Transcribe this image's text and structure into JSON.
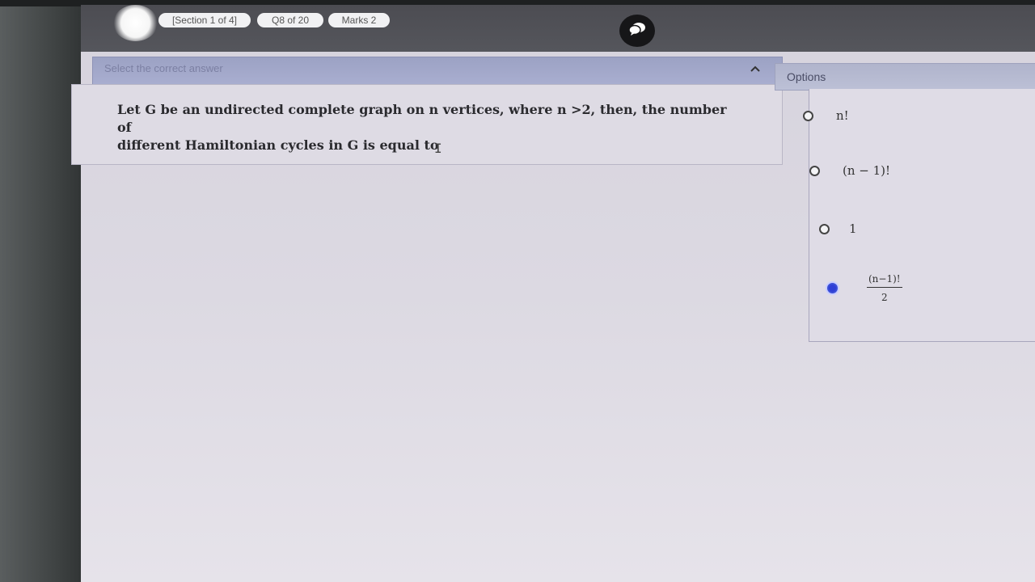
{
  "header": {
    "section": "[Section 1 of 4]",
    "question_no": "Q8 of 20",
    "marks": "Marks 2"
  },
  "question": {
    "instruction": "Select the correct answer",
    "text_line1": "Let G be an undirected complete graph on n vertices, where n >2, then, the number of",
    "text_line2": "different Hamiltonian cycles in G is equal to"
  },
  "options": {
    "title": "Options",
    "items": [
      {
        "text": "n!",
        "selected": false
      },
      {
        "text": "(n − 1)!",
        "selected": false
      },
      {
        "text": "1",
        "selected": false
      },
      {
        "numerator": "(n−1)!",
        "denominator": "2",
        "selected": true
      }
    ]
  },
  "icons": {
    "chat": "chat-bubbles-icon",
    "collapse": "chevron-up-icon"
  },
  "colors": {
    "topbar": "#4c4c52",
    "question_header": "#a3a8ca",
    "selected_radio": "#2f3fd6"
  }
}
